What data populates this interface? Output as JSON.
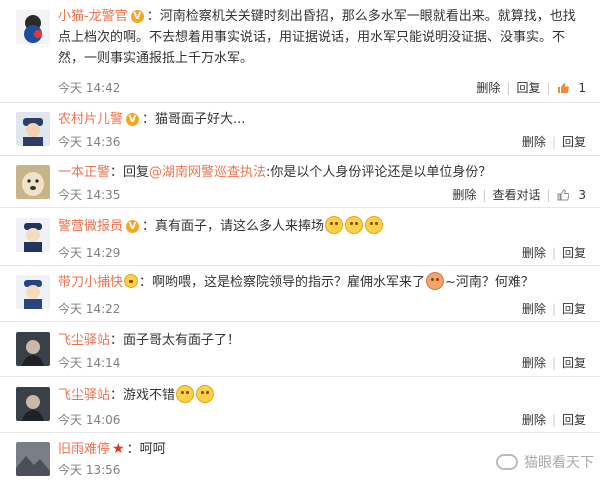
{
  "comments": [
    {
      "user": "小猫-龙警官",
      "verified": "V",
      "text": "：河南检察机关关键时刻出昏招，那么多水军一眼就看出来。就算找，也找点上档次的啊。不去想着用事实说话，用证据说话，用水军只能说明没证据、没事实。不然，一则事实通报抵上千万水军。",
      "time": "今天 14:42",
      "delete": "删除",
      "reply": "回复",
      "likes": "1"
    },
    {
      "user": "农村片儿警",
      "verified": "V",
      "text": "：猫哥面子好大...",
      "time": "今天 14:36",
      "delete": "删除",
      "reply": "回复"
    },
    {
      "user": "一本正警",
      "reply_prefix": "：回复",
      "mention": "@湖南网警巡查执法",
      "text": ":你是以个人身份评论还是以单位身份？",
      "time": "今天 14:35",
      "delete": "删除",
      "view_conv": "查看对话",
      "likes": "3"
    },
    {
      "user": "警营微报员",
      "verified": "V",
      "text": "：真有面子，请这么多人来捧场",
      "time": "今天 14:29",
      "delete": "删除",
      "reply": "回复"
    },
    {
      "user": "带刀小捕快",
      "text": "：啊哟喂，这是检察院领导的指示？雇佣水军来了",
      "text2": "~河南？何难？",
      "time": "今天 14:22",
      "delete": "删除",
      "reply": "回复"
    },
    {
      "user": "飞尘驿站",
      "text": "：面子哥太有面子了！",
      "time": "今天 14:14",
      "delete": "删除",
      "reply": "回复"
    },
    {
      "user": "飞尘驿站",
      "text": "：游戏不错",
      "time": "今天 14:06",
      "delete": "删除",
      "reply": "回复"
    },
    {
      "user": "旧雨难停",
      "text": "：呵呵",
      "time": "今天 13:56"
    }
  ],
  "watermark": "猫眼看天下",
  "colors": {
    "username": "#eb7350",
    "verified": "#f5a623"
  }
}
